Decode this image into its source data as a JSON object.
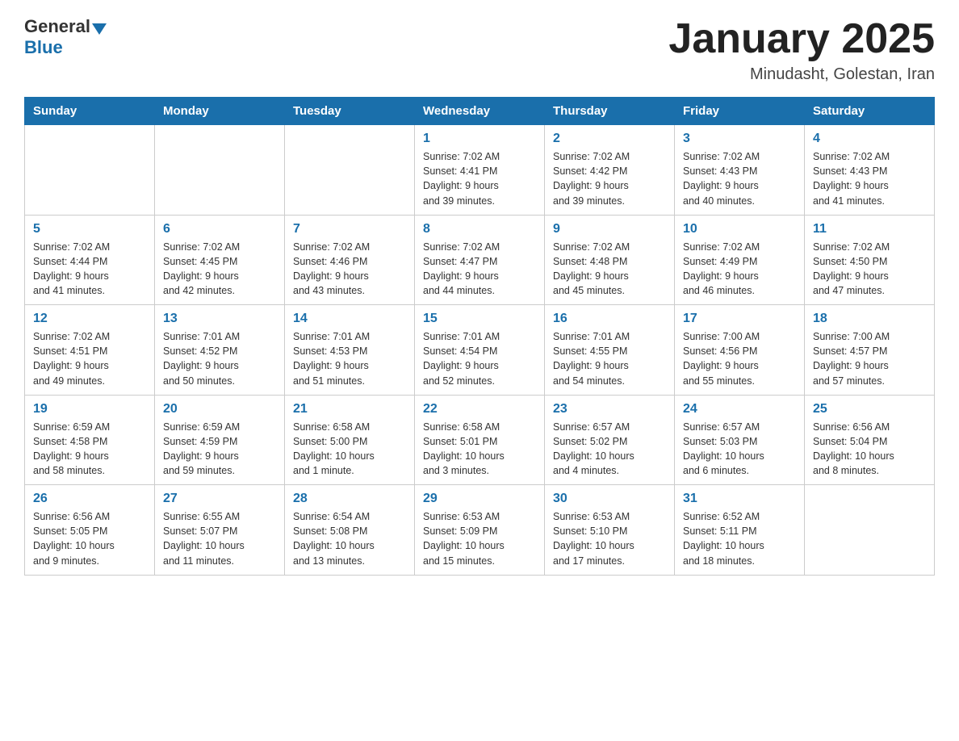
{
  "header": {
    "logo_general": "General",
    "logo_blue": "Blue",
    "month_title": "January 2025",
    "subtitle": "Minudasht, Golestan, Iran"
  },
  "days_of_week": [
    "Sunday",
    "Monday",
    "Tuesday",
    "Wednesday",
    "Thursday",
    "Friday",
    "Saturday"
  ],
  "weeks": [
    [
      {
        "day": "",
        "info": ""
      },
      {
        "day": "",
        "info": ""
      },
      {
        "day": "",
        "info": ""
      },
      {
        "day": "1",
        "info": "Sunrise: 7:02 AM\nSunset: 4:41 PM\nDaylight: 9 hours\nand 39 minutes."
      },
      {
        "day": "2",
        "info": "Sunrise: 7:02 AM\nSunset: 4:42 PM\nDaylight: 9 hours\nand 39 minutes."
      },
      {
        "day": "3",
        "info": "Sunrise: 7:02 AM\nSunset: 4:43 PM\nDaylight: 9 hours\nand 40 minutes."
      },
      {
        "day": "4",
        "info": "Sunrise: 7:02 AM\nSunset: 4:43 PM\nDaylight: 9 hours\nand 41 minutes."
      }
    ],
    [
      {
        "day": "5",
        "info": "Sunrise: 7:02 AM\nSunset: 4:44 PM\nDaylight: 9 hours\nand 41 minutes."
      },
      {
        "day": "6",
        "info": "Sunrise: 7:02 AM\nSunset: 4:45 PM\nDaylight: 9 hours\nand 42 minutes."
      },
      {
        "day": "7",
        "info": "Sunrise: 7:02 AM\nSunset: 4:46 PM\nDaylight: 9 hours\nand 43 minutes."
      },
      {
        "day": "8",
        "info": "Sunrise: 7:02 AM\nSunset: 4:47 PM\nDaylight: 9 hours\nand 44 minutes."
      },
      {
        "day": "9",
        "info": "Sunrise: 7:02 AM\nSunset: 4:48 PM\nDaylight: 9 hours\nand 45 minutes."
      },
      {
        "day": "10",
        "info": "Sunrise: 7:02 AM\nSunset: 4:49 PM\nDaylight: 9 hours\nand 46 minutes."
      },
      {
        "day": "11",
        "info": "Sunrise: 7:02 AM\nSunset: 4:50 PM\nDaylight: 9 hours\nand 47 minutes."
      }
    ],
    [
      {
        "day": "12",
        "info": "Sunrise: 7:02 AM\nSunset: 4:51 PM\nDaylight: 9 hours\nand 49 minutes."
      },
      {
        "day": "13",
        "info": "Sunrise: 7:01 AM\nSunset: 4:52 PM\nDaylight: 9 hours\nand 50 minutes."
      },
      {
        "day": "14",
        "info": "Sunrise: 7:01 AM\nSunset: 4:53 PM\nDaylight: 9 hours\nand 51 minutes."
      },
      {
        "day": "15",
        "info": "Sunrise: 7:01 AM\nSunset: 4:54 PM\nDaylight: 9 hours\nand 52 minutes."
      },
      {
        "day": "16",
        "info": "Sunrise: 7:01 AM\nSunset: 4:55 PM\nDaylight: 9 hours\nand 54 minutes."
      },
      {
        "day": "17",
        "info": "Sunrise: 7:00 AM\nSunset: 4:56 PM\nDaylight: 9 hours\nand 55 minutes."
      },
      {
        "day": "18",
        "info": "Sunrise: 7:00 AM\nSunset: 4:57 PM\nDaylight: 9 hours\nand 57 minutes."
      }
    ],
    [
      {
        "day": "19",
        "info": "Sunrise: 6:59 AM\nSunset: 4:58 PM\nDaylight: 9 hours\nand 58 minutes."
      },
      {
        "day": "20",
        "info": "Sunrise: 6:59 AM\nSunset: 4:59 PM\nDaylight: 9 hours\nand 59 minutes."
      },
      {
        "day": "21",
        "info": "Sunrise: 6:58 AM\nSunset: 5:00 PM\nDaylight: 10 hours\nand 1 minute."
      },
      {
        "day": "22",
        "info": "Sunrise: 6:58 AM\nSunset: 5:01 PM\nDaylight: 10 hours\nand 3 minutes."
      },
      {
        "day": "23",
        "info": "Sunrise: 6:57 AM\nSunset: 5:02 PM\nDaylight: 10 hours\nand 4 minutes."
      },
      {
        "day": "24",
        "info": "Sunrise: 6:57 AM\nSunset: 5:03 PM\nDaylight: 10 hours\nand 6 minutes."
      },
      {
        "day": "25",
        "info": "Sunrise: 6:56 AM\nSunset: 5:04 PM\nDaylight: 10 hours\nand 8 minutes."
      }
    ],
    [
      {
        "day": "26",
        "info": "Sunrise: 6:56 AM\nSunset: 5:05 PM\nDaylight: 10 hours\nand 9 minutes."
      },
      {
        "day": "27",
        "info": "Sunrise: 6:55 AM\nSunset: 5:07 PM\nDaylight: 10 hours\nand 11 minutes."
      },
      {
        "day": "28",
        "info": "Sunrise: 6:54 AM\nSunset: 5:08 PM\nDaylight: 10 hours\nand 13 minutes."
      },
      {
        "day": "29",
        "info": "Sunrise: 6:53 AM\nSunset: 5:09 PM\nDaylight: 10 hours\nand 15 minutes."
      },
      {
        "day": "30",
        "info": "Sunrise: 6:53 AM\nSunset: 5:10 PM\nDaylight: 10 hours\nand 17 minutes."
      },
      {
        "day": "31",
        "info": "Sunrise: 6:52 AM\nSunset: 5:11 PM\nDaylight: 10 hours\nand 18 minutes."
      },
      {
        "day": "",
        "info": ""
      }
    ]
  ]
}
